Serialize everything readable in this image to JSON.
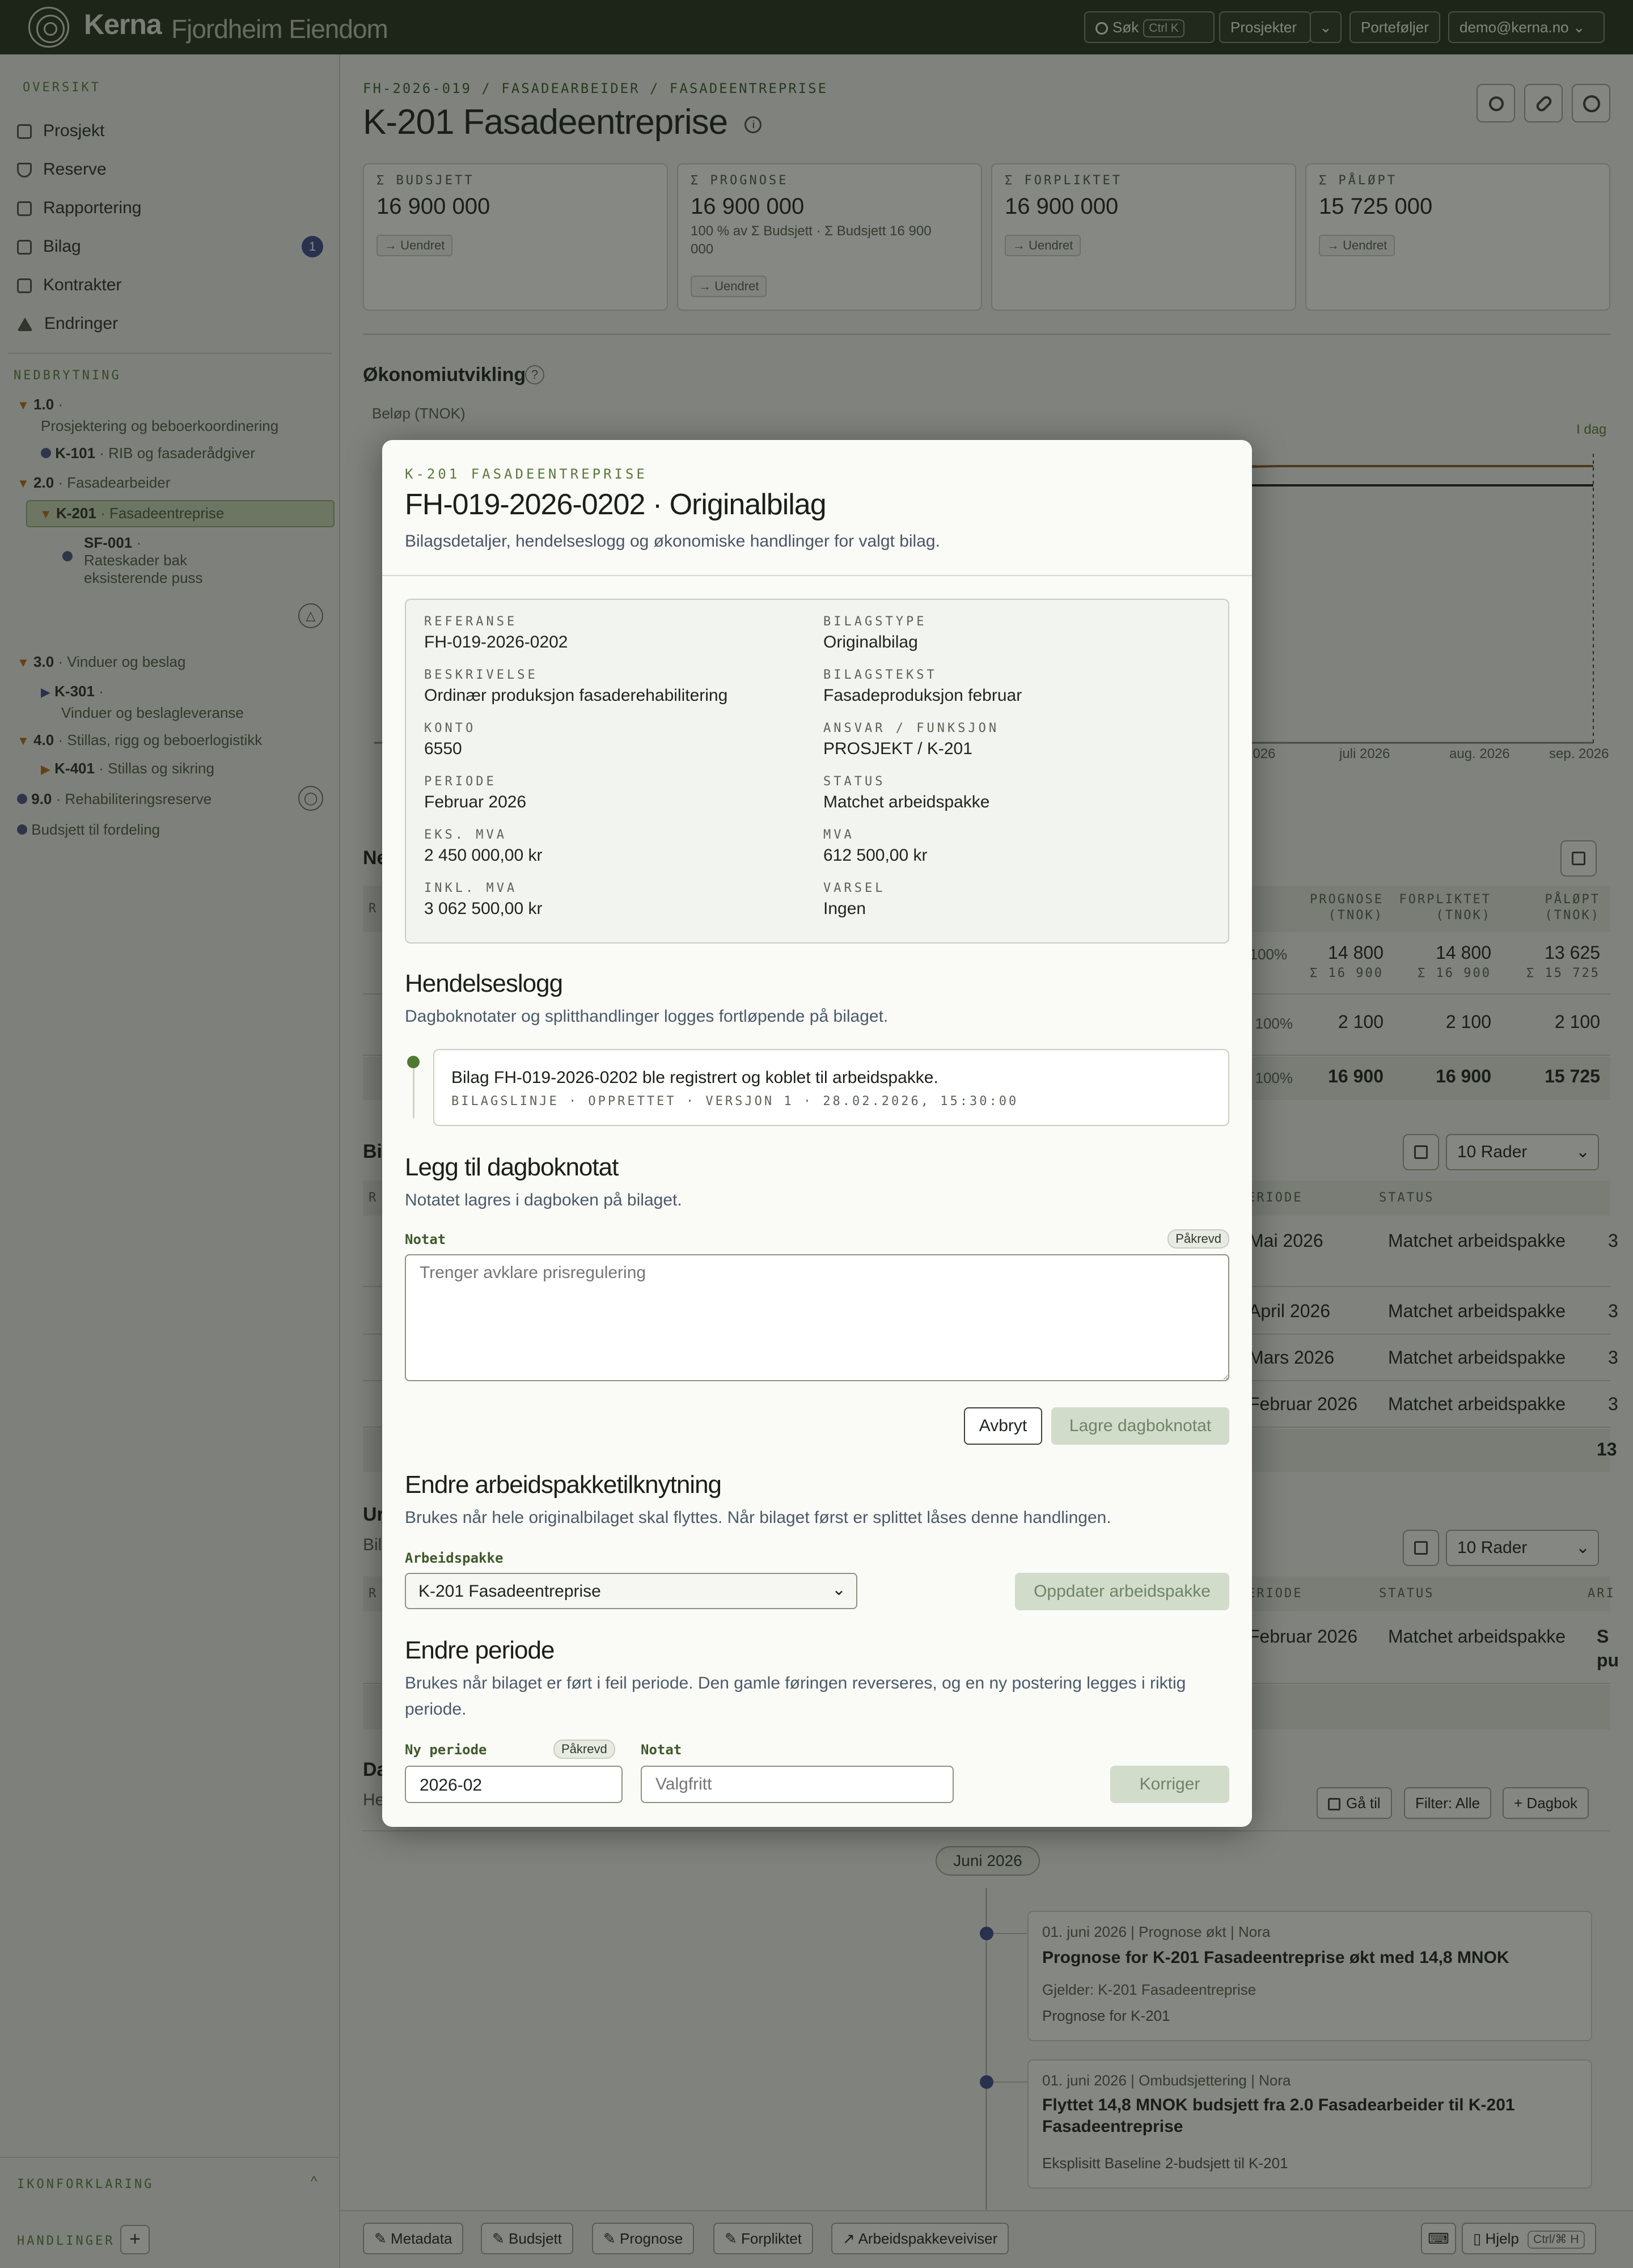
{
  "topbar": {
    "brand": "Kerna",
    "org": "Fjordheim Eiendom",
    "search_label": "Søk",
    "search_shortcut": "Ctrl K",
    "projects_label": "Prosjekter",
    "portfolios_label": "Porteføljer",
    "user_email": "demo@kerna.no"
  },
  "sidebar": {
    "overview_title": "OVERSIKT",
    "nav": [
      {
        "label": "Prosjekt",
        "icon": "grid-icon"
      },
      {
        "label": "Reserve",
        "icon": "shield-icon"
      },
      {
        "label": "Rapportering",
        "icon": "chart-icon"
      },
      {
        "label": "Bilag",
        "icon": "inbox-icon",
        "badge": "1"
      },
      {
        "label": "Kontrakter",
        "icon": "handshake-icon"
      },
      {
        "label": "Endringer",
        "icon": "triangle-icon"
      }
    ],
    "breakdown_title": "NEDBRYTNING",
    "tree": {
      "n1_code": "1.0",
      "n1_label": "Prosjektering og beboerkoordinering",
      "n1a_code": "K-101",
      "n1a_label": "RIB og fasaderådgiver",
      "n2_code": "2.0",
      "n2_label": "Fasadearbeider",
      "n2a_code": "K-201",
      "n2a_label": "Fasadeentreprise",
      "n2b_code": "SF-001",
      "n2b_label1": "Rateskader bak",
      "n2b_label2": "eksisterende puss",
      "n3_code": "3.0",
      "n3_label": "Vinduer og beslag",
      "n3a_code": "K-301",
      "n3a_label": "Vinduer og beslagleveranse",
      "n4_code": "4.0",
      "n4_label": "Stillas, rigg og beboerlogistikk",
      "n4a_code": "K-401",
      "n4a_label": "Stillas og sikring",
      "n9_code": "9.0",
      "n9_label": "Rehabiliteringsreserve",
      "budget_label": "Budsjett til fordeling"
    },
    "legend_title": "IKONFORKLARING",
    "actions_title": "HANDLINGER"
  },
  "page": {
    "breadcrumb": "FH-2026-019 / FASADEARBEIDER / FASADEENTREPRISE",
    "title": "K-201 Fasadeentreprise",
    "kpis": [
      {
        "label": "Σ BUDSJETT",
        "value": "16 900 000",
        "change": "Uendret"
      },
      {
        "label": "Σ PROGNOSE",
        "value": "16 900 000",
        "note1": "100 % av Σ Budsjett · Σ Budsjett 16 900",
        "note2": "000",
        "change": "Uendret"
      },
      {
        "label": "Σ FORPLIKTET",
        "value": "16 900 000",
        "change": "Uendret"
      },
      {
        "label": "Σ PÅLØPT",
        "value": "15 725 000",
        "change": "Uendret"
      }
    ],
    "econ_title": "Økonomiutvikling",
    "chart_ylabel": "Beløp (TNOK)",
    "today_label": "I dag",
    "chart_xticks": [
      "2026",
      "juli 2026",
      "aug. 2026",
      "sep. 2026"
    ],
    "table1": {
      "headers": [
        "PROGNOSE (TNOK)",
        "FORPLIKTET (TNOK)",
        "PÅLØPT (TNOK)"
      ],
      "h_prog1": "PROGNOSE",
      "h_prog2": "(TNOK)",
      "h_forp1": "FORPLIKTET",
      "h_forp2": "(TNOK)",
      "h_palo1": "PÅLØPT",
      "h_palo2": "(TNOK)",
      "rows": [
        {
          "pct": "100%",
          "prog": "14 800",
          "forp": "14 800",
          "palo": "13 625",
          "prog_sub": "Σ 16 900",
          "forp_sub": "Σ 16 900",
          "palo_sub": "Σ 15 725"
        },
        {
          "pct": "100%",
          "prog": "2 100",
          "forp": "2 100",
          "palo": "2 100"
        },
        {
          "pct": "100%",
          "prog": "16 900",
          "forp": "16 900",
          "palo": "15 725"
        }
      ],
      "left_heading": "Ne",
      "left_col": "R"
    },
    "table2": {
      "left_heading": "Bi",
      "left_col": "R",
      "rows_select": "10 Rader",
      "h_period": "ERIODE",
      "h_status": "STATUS",
      "rows": [
        {
          "period": "Mai 2026",
          "status": "Matchet arbeidspakke",
          "tail": "3"
        },
        {
          "period": "April 2026",
          "status": "Matchet arbeidspakke",
          "tail": "3"
        },
        {
          "period": "Mars 2026",
          "status": "Matchet arbeidspakke",
          "tail": "3"
        },
        {
          "period": "Februar 2026",
          "status": "Matchet arbeidspakke",
          "tail": "3"
        }
      ],
      "sum_tail": "13"
    },
    "table3": {
      "left_heading": "Ur",
      "left_sub": "Bil",
      "left_col": "R",
      "rows_select": "10 Rader",
      "h_period": "ERIODE",
      "h_status": "STATUS",
      "h_tail": "ARI",
      "row_period": "Februar 2026",
      "row_status": "Matchet arbeidspakke",
      "row_tail1": "S",
      "row_tail2": "pu"
    },
    "journal": {
      "heading": "Da",
      "sub": "He",
      "goto_label": "Gå til",
      "filter_label": "Filter: Alle",
      "add_label": "Dagbok",
      "month_label": "Juni 2026",
      "entries": [
        {
          "date": "01. juni 2026",
          "type": "Prognose økt",
          "author": "Nora",
          "title": "Prognose for K-201 Fasadeentreprise økt med 14,8 MNOK",
          "applies": "Gjelder: K-201 Fasadeentreprise",
          "note": "Prognose for K-201"
        },
        {
          "date": "01. juni 2026",
          "type": "Ombudsjettering",
          "author": "Nora",
          "title1": "Flyttet 14,8 MNOK budsjett fra 2.0 Fasadearbeider til K-201",
          "title2": "Fasadeentreprise",
          "note": "Eksplisitt Baseline 2-budsjett til K-201"
        }
      ]
    },
    "bottom_actions": [
      "Metadata",
      "Budsjett",
      "Prognose",
      "Forpliktet",
      "Arbeidspakkeveiviser"
    ],
    "help_label": "Hjelp",
    "help_shortcut": "Ctrl/⌘ H"
  },
  "modal": {
    "kicker": "K-201 FASADEENTREPRISE",
    "title": "FH-019-2026-0202 · Originalbilag",
    "subtitle": "Bilagsdetaljer, hendelseslogg og økonomiske handlinger for valgt bilag.",
    "details": {
      "ref_label": "REFERANSE",
      "ref_value": "FH-019-2026-0202",
      "type_label": "BILAGSTYPE",
      "type_value": "Originalbilag",
      "desc_label": "BESKRIVELSE",
      "desc_value": "Ordinær produksjon fasaderehabilitering",
      "text_label": "BILAGSTEKST",
      "text_value": "Fasadeproduksjon februar",
      "acct_label": "KONTO",
      "acct_value": "6550",
      "resp_label": "ANSVAR / FUNKSJON",
      "resp_value": "PROSJEKT / K-201",
      "period_label": "PERIODE",
      "period_value": "Februar 2026",
      "status_label": "STATUS",
      "status_value": "Matchet arbeidspakke",
      "ex_label": "EKS. MVA",
      "ex_value": "2 450 000,00 kr",
      "vat_label": "MVA",
      "vat_value": "612 500,00 kr",
      "inc_label": "INKL. MVA",
      "inc_value": "3 062 500,00 kr",
      "warn_label": "VARSEL",
      "warn_value": "Ingen"
    },
    "log": {
      "title": "Hendelseslogg",
      "subtitle": "Dagboknotater og splitthandlinger logges fortløpende på bilaget.",
      "entry_text": "Bilag FH-019-2026-0202 ble registrert og koblet til arbeidspakke.",
      "entry_meta": "BILAGSLINJE · OPPRETTET · VERSJON 1 · 28.02.2026, 15:30:00"
    },
    "note": {
      "title": "Legg til dagboknotat",
      "subtitle": "Notatet lagres i dagboken på bilaget.",
      "label": "Notat",
      "required": "Påkrevd",
      "placeholder": "Trenger avklare prisregulering",
      "cancel": "Avbryt",
      "save": "Lagre dagboknotat"
    },
    "wp": {
      "title": "Endre arbeidspakketilknytning",
      "subtitle": "Brukes når hele originalbilaget skal flyttes. Når bilaget først er splittet låses denne handlingen.",
      "label": "Arbeidspakke",
      "selected": "K-201 Fasadeentreprise",
      "button": "Oppdater arbeidspakke"
    },
    "period": {
      "title": "Endre periode",
      "subtitle1": "Brukes når bilaget er ført i feil periode. Den gamle føringen reverseres, og en ny postering legges i riktig",
      "subtitle2": "periode.",
      "new_label": "Ny periode",
      "required": "Påkrevd",
      "new_value": "2026-02",
      "note_label": "Notat",
      "note_placeholder": "Valgfritt",
      "button": "Korriger"
    }
  }
}
